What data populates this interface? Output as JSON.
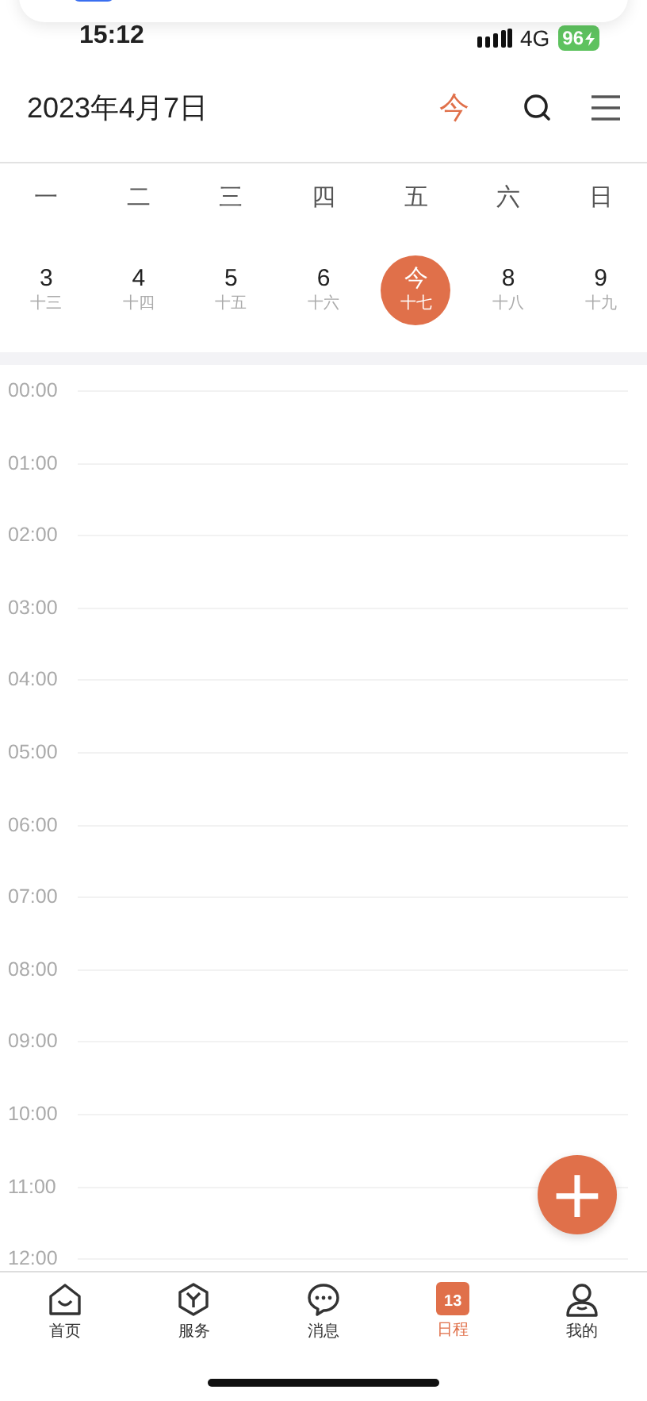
{
  "status_bar": {
    "time": "15:12",
    "network": "4G",
    "battery": "96"
  },
  "header": {
    "title": "2023年4月7日",
    "today_button": "今"
  },
  "week": {
    "weekdays": [
      "一",
      "二",
      "三",
      "四",
      "五",
      "六",
      "日"
    ],
    "days": [
      {
        "date": "3",
        "lunar": "十三",
        "selected": false
      },
      {
        "date": "4",
        "lunar": "十四",
        "selected": false
      },
      {
        "date": "5",
        "lunar": "十五",
        "selected": false
      },
      {
        "date": "6",
        "lunar": "十六",
        "selected": false
      },
      {
        "date": "今",
        "lunar": "十七",
        "selected": true
      },
      {
        "date": "8",
        "lunar": "十八",
        "selected": false
      },
      {
        "date": "9",
        "lunar": "十九",
        "selected": false
      }
    ]
  },
  "timeline": {
    "hours": [
      "00:00",
      "01:00",
      "02:00",
      "03:00",
      "04:00",
      "05:00",
      "06:00",
      "07:00",
      "08:00",
      "09:00",
      "10:00",
      "11:00",
      "12:00"
    ]
  },
  "add_button": {
    "label": "+"
  },
  "tab_bar": [
    {
      "label": "首页",
      "kind": "home",
      "selected": false
    },
    {
      "label": "服务",
      "kind": "box",
      "selected": false
    },
    {
      "label": "消息",
      "kind": "chat",
      "selected": false
    },
    {
      "label": "日程",
      "kind": "calendar",
      "icon_text": "13",
      "selected": true
    },
    {
      "label": "我的",
      "kind": "person",
      "selected": false
    }
  ]
}
